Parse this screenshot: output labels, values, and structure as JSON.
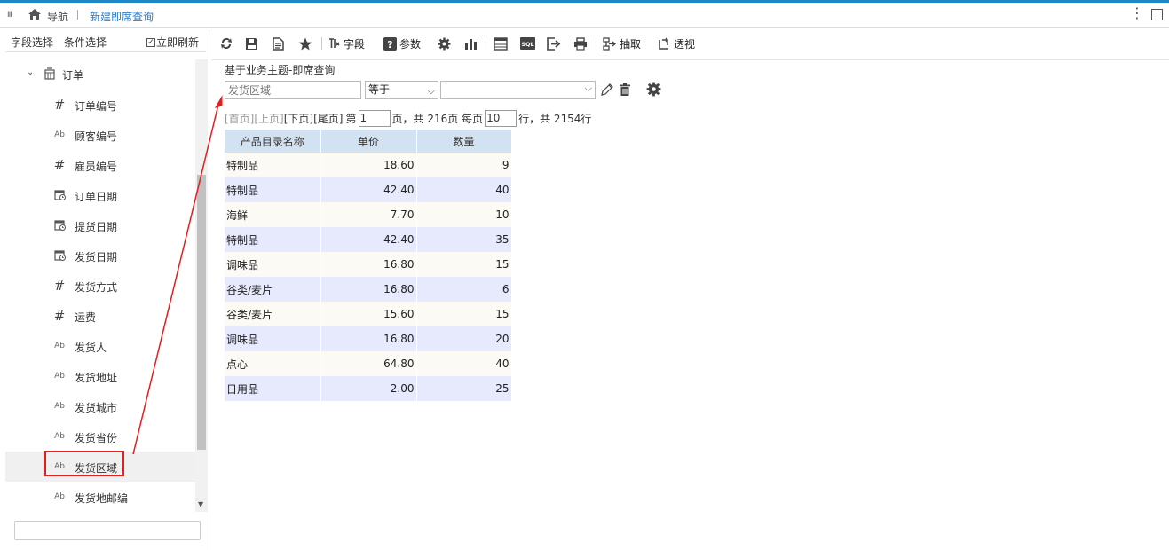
{
  "topbar": {
    "nav_label": "导航",
    "tab_title": "新建即席查询"
  },
  "left": {
    "tabs": [
      "字段选择",
      "条件选择"
    ],
    "refresh_label": "立即刷新",
    "root": {
      "label": "订单"
    },
    "fields": [
      {
        "label": "订单编号",
        "icon": "hash-icon"
      },
      {
        "label": "顾客编号",
        "icon": "text-type-icon"
      },
      {
        "label": "雇员编号",
        "icon": "hash-icon"
      },
      {
        "label": "订单日期",
        "icon": "calendar-icon"
      },
      {
        "label": "提货日期",
        "icon": "calendar-icon"
      },
      {
        "label": "发货日期",
        "icon": "calendar-icon"
      },
      {
        "label": "发货方式",
        "icon": "hash-icon"
      },
      {
        "label": "运费",
        "icon": "hash-icon"
      },
      {
        "label": "发货人",
        "icon": "text-type-icon"
      },
      {
        "label": "发货地址",
        "icon": "text-type-icon"
      },
      {
        "label": "发货城市",
        "icon": "text-type-icon"
      },
      {
        "label": "发货省份",
        "icon": "text-type-icon"
      },
      {
        "label": "发货区域",
        "icon": "text-type-icon",
        "selected": true
      },
      {
        "label": "发货地邮编",
        "icon": "text-type-icon"
      }
    ]
  },
  "toolbar": {
    "fields_label": "字段",
    "params_label": "参数",
    "extract_label": "抽取",
    "pivot_label": "透视",
    "sql_label": "SQL"
  },
  "query": {
    "subject": "基于业务主题-即席查询",
    "condition_field_placeholder": "发货区域",
    "operator": "等于",
    "value": ""
  },
  "pager": {
    "first": "[首页]",
    "prev": "[上页]",
    "next": "[下页]",
    "last": "[尾页]",
    "page_prefix": "第",
    "page": "1",
    "page_mid": "页，共 216页 每页",
    "per_page": "10",
    "rows_suffix": "行，共 2154行"
  },
  "table": {
    "columns": [
      "产品目录名称",
      "单价",
      "数量"
    ],
    "rows": [
      [
        "特制品",
        "18.60",
        "9"
      ],
      [
        "特制品",
        "42.40",
        "40"
      ],
      [
        "海鲜",
        "7.70",
        "10"
      ],
      [
        "特制品",
        "42.40",
        "35"
      ],
      [
        "调味品",
        "16.80",
        "15"
      ],
      [
        "谷类/麦片",
        "16.80",
        "6"
      ],
      [
        "谷类/麦片",
        "15.60",
        "15"
      ],
      [
        "调味品",
        "16.80",
        "20"
      ],
      [
        "点心",
        "64.80",
        "40"
      ],
      [
        "日用品",
        "2.00",
        "25"
      ]
    ]
  },
  "colors": {
    "accent": "#1e88c8",
    "link": "#2b7cc4",
    "highlight": "#e02020",
    "header_bg": "#d3e2f1",
    "row_alt": "#e6eafc"
  }
}
